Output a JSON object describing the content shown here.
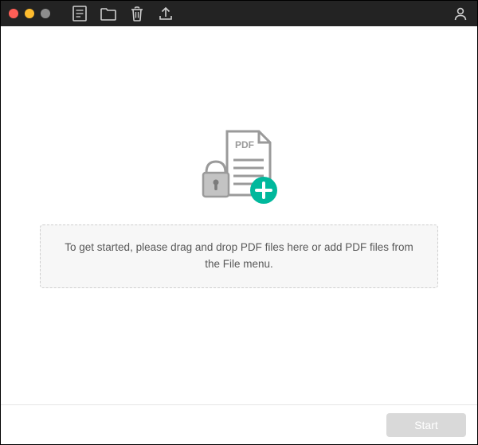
{
  "toolbar": {
    "icons": {
      "new_doc": "new-document-icon",
      "folder": "open-folder-icon",
      "trash": "trash-icon",
      "upload": "upload-icon",
      "user": "user-icon"
    }
  },
  "main": {
    "illustration": {
      "pdf_label": "PDF",
      "lock": "lock-icon",
      "plus": "plus-add-icon"
    },
    "drop_message": "To get started, please drag and drop PDF files here or add PDF files from the File menu."
  },
  "footer": {
    "start_label": "Start",
    "start_enabled": false
  },
  "colors": {
    "accent": "#00b89c",
    "titlebar": "#232323",
    "drop_border": "#cfcfcf",
    "drop_bg": "#f7f7f7"
  }
}
